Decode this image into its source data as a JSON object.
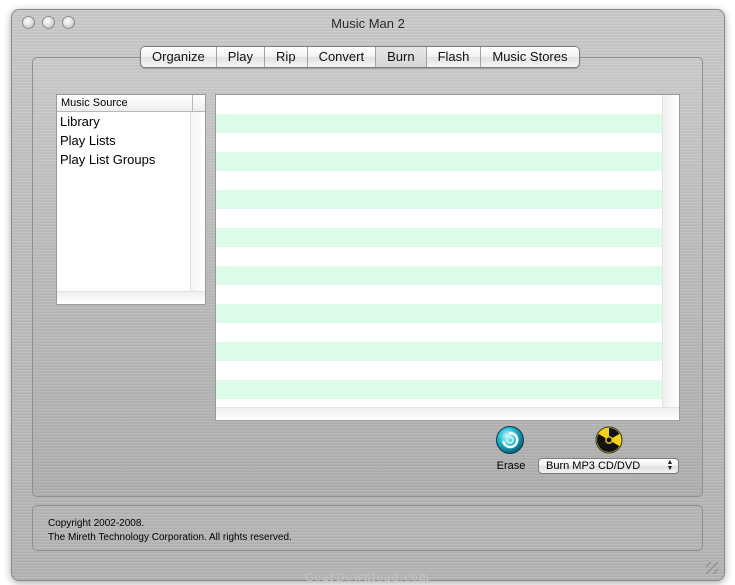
{
  "window": {
    "title": "Music Man 2"
  },
  "tabs": [
    {
      "label": "Organize"
    },
    {
      "label": "Play"
    },
    {
      "label": "Rip"
    },
    {
      "label": "Convert"
    },
    {
      "label": "Burn",
      "selected": true
    },
    {
      "label": "Flash"
    },
    {
      "label": "Music Stores"
    }
  ],
  "source_list": {
    "header": "Music Source",
    "items": [
      "Library",
      "Play Lists",
      "Play List Groups"
    ]
  },
  "actions": {
    "erase_label": "Erase",
    "burn_selected": "Burn MP3 CD/DVD"
  },
  "footer": {
    "line1": "Copyright 2002-2008.",
    "line2": "The Mireth Technology Corporation. All rights reserved."
  },
  "watermark": "GearDownload.com",
  "colors": {
    "stripe": "#dcfbe9",
    "accent_erase": "#27c0d6",
    "accent_burn": "#f2d21b"
  }
}
